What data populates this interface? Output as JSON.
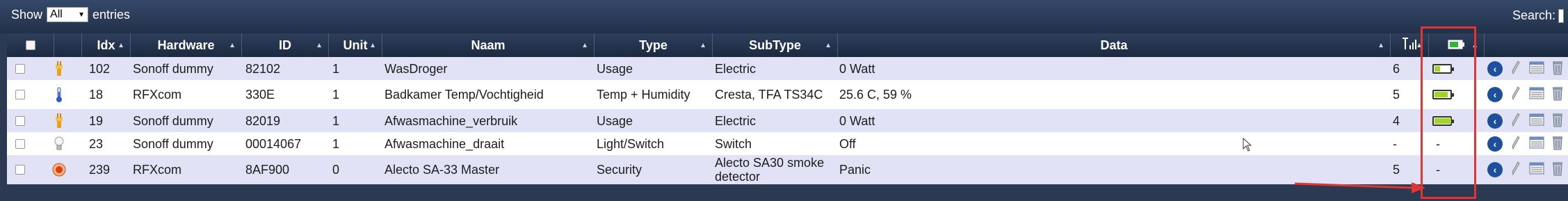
{
  "toolbar": {
    "show_label": "Show",
    "entries_value": "All",
    "entries_label": "entries",
    "search_label": "Search:",
    "search_value": ""
  },
  "columns": [
    "Idx",
    "Hardware",
    "ID",
    "Unit",
    "Naam",
    "Type",
    "SubType",
    "Data"
  ],
  "rows": [
    {
      "idx": "102",
      "hardware": "Sonoff dummy",
      "id": "82102",
      "unit": "1",
      "naam": "WasDroger",
      "type": "Usage",
      "subtype": "Electric",
      "data": "0 Watt",
      "signal": "6",
      "battery": "",
      "icon": "power-plug-icon",
      "battery_level": 0.35
    },
    {
      "idx": "18",
      "hardware": "RFXcom",
      "id": "330E",
      "unit": "1",
      "naam": "Badkamer Temp/Vochtigheid",
      "type": "Temp + Humidity",
      "subtype": "Cresta, TFA TS34C",
      "data": "25.6 C, 59 %",
      "signal": "5",
      "battery": "",
      "icon": "thermometer-icon",
      "battery_level": 0.8
    },
    {
      "idx": "19",
      "hardware": "Sonoff dummy",
      "id": "82019",
      "unit": "1",
      "naam": "Afwasmachine_verbruik",
      "type": "Usage",
      "subtype": "Electric",
      "data": "0 Watt",
      "signal": "4",
      "battery": "",
      "icon": "power-plug-icon",
      "battery_level": 1.0
    },
    {
      "idx": "23",
      "hardware": "Sonoff dummy",
      "id": "00014067",
      "unit": "1",
      "naam": "Afwasmachine_draait",
      "type": "Light/Switch",
      "subtype": "Switch",
      "data": "Off",
      "signal": "-",
      "battery": "-",
      "icon": "light-bulb-icon",
      "battery_level": null
    },
    {
      "idx": "239",
      "hardware": "RFXcom",
      "id": "8AF900",
      "unit": "0",
      "naam": "Alecto SA-33 Master",
      "type": "Security",
      "subtype": "Alecto SA30 smoke detector",
      "data": "Panic",
      "signal": "5",
      "battery": "-",
      "icon": "smoke-alarm-icon",
      "battery_level": null
    }
  ],
  "colors": {
    "header": "#1c2a40",
    "row_odd": "#e2e2f6",
    "row_even": "#ffffff",
    "highlight": "#e03535",
    "battery_fill": "#a4d42a"
  }
}
